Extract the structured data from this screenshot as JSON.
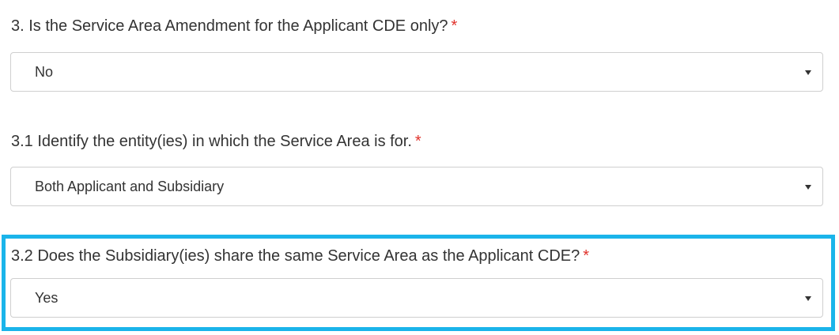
{
  "questions": [
    {
      "label": "3. Is the Service Area Amendment for the Applicant CDE only?",
      "required_mark": "*",
      "selected_value": "No"
    },
    {
      "label": "3.1 Identify the entity(ies) in which the Service Area is for.",
      "required_mark": "*",
      "selected_value": "Both Applicant and Subsidiary"
    },
    {
      "label": "3.2 Does the Subsidiary(ies) share the same Service Area as the Applicant CDE?",
      "required_mark": "*",
      "selected_value": "Yes"
    }
  ],
  "colors": {
    "highlight": "#1ab4ea",
    "required": "#e0322b",
    "text": "#333333",
    "border": "#cfcfcf"
  },
  "icons": {
    "dropdown": "caret-down-icon"
  }
}
